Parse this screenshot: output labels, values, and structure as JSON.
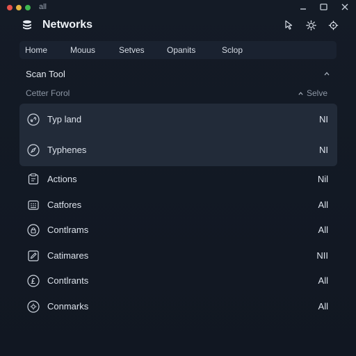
{
  "window": {
    "title": "all"
  },
  "header": {
    "title": "Networks",
    "icons": [
      "cursor-icon",
      "gear-icon",
      "settings-icon"
    ]
  },
  "nav": {
    "items": [
      {
        "label": "Home"
      },
      {
        "label": "Mouus"
      },
      {
        "label": "Setves"
      },
      {
        "label": "Opanits"
      },
      {
        "label": "Sclop"
      }
    ]
  },
  "section": {
    "title": "Scan Tool",
    "filter_label": "Cetter Forol",
    "sort_label": "Selve"
  },
  "rows": [
    {
      "label": "Typ land",
      "value": "NI",
      "icon": "link-circle-icon",
      "highlighted": true
    },
    {
      "label": "Typhenes",
      "value": "NI",
      "icon": "compass-circle-icon",
      "highlighted": true
    },
    {
      "label": "Actions",
      "value": "Nil",
      "icon": "clipboard-icon"
    },
    {
      "label": "Catfores",
      "value": "All",
      "icon": "grid-box-icon"
    },
    {
      "label": "Contlrams",
      "value": "All",
      "icon": "lock-circle-icon"
    },
    {
      "label": "Catimares",
      "value": "NII",
      "icon": "edit-box-icon"
    },
    {
      "label": "Contlrants",
      "value": "All",
      "icon": "currency-circle-icon"
    },
    {
      "label": "Conmarks",
      "value": "All",
      "icon": "gear-circle-icon"
    }
  ],
  "colors": {
    "background": "#121823",
    "panel": "#1a2230",
    "highlight": "#222b39",
    "text": "#dde3ec",
    "muted": "#8d97a5"
  }
}
